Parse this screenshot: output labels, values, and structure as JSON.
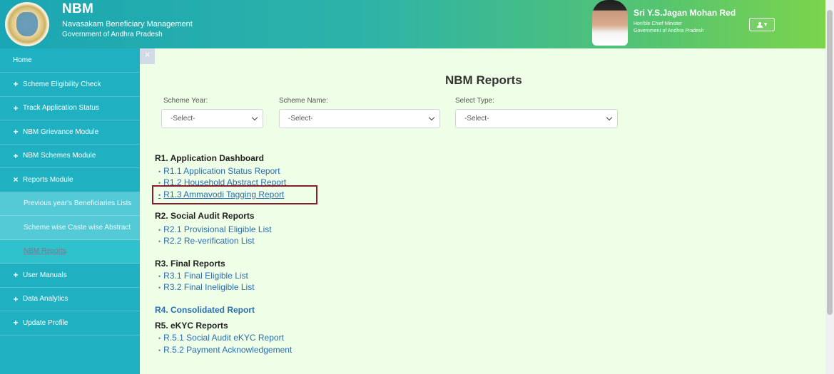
{
  "header": {
    "title": "NBM",
    "subtitle": "Navasakam Beneficiary Management",
    "gov": "Government of Andhra Pradesh",
    "cm_name": "Sri Y.S.Jagan Mohan Reddy",
    "cm_role": "Hon'ble Chief Minister",
    "cm_gov": "Government of Andhra Pradesh"
  },
  "sidebar": {
    "items": [
      {
        "label": "Home",
        "icon": "",
        "type": "home"
      },
      {
        "label": "Scheme Eligibility Check",
        "icon": "+",
        "type": "main"
      },
      {
        "label": "Track Application Status",
        "icon": "+",
        "type": "main"
      },
      {
        "label": "NBM Grievance Module",
        "icon": "+",
        "type": "main"
      },
      {
        "label": "NBM Schemes Module",
        "icon": "+",
        "type": "main"
      },
      {
        "label": "Reports Module",
        "icon": "×",
        "type": "main"
      },
      {
        "label": "Previous year's Beneficiaries Lists",
        "icon": "",
        "type": "sub"
      },
      {
        "label": "Scheme wise Caste wise Abstract",
        "icon": "",
        "type": "sub"
      },
      {
        "label": "NBM Reports",
        "icon": "",
        "type": "sub-active"
      },
      {
        "label": "User Manuals",
        "icon": "+",
        "type": "main"
      },
      {
        "label": "Data Analytics",
        "icon": "+",
        "type": "main"
      },
      {
        "label": "Update Profile",
        "icon": "+",
        "type": "main"
      }
    ],
    "close": "×"
  },
  "main": {
    "title": "NBM Reports",
    "filters": [
      {
        "label": "Scheme Year:",
        "value": "-Select-"
      },
      {
        "label": "Scheme Name:",
        "value": "-Select-"
      },
      {
        "label": "Select Type:",
        "value": "-Select-"
      }
    ],
    "sections": {
      "r1": {
        "title": "R1. Application Dashboard",
        "links": [
          "R1.1 Application Status Report",
          "R1.2 Household Abstract Report",
          "R1.3 Ammavodi Tagging Report"
        ]
      },
      "r2": {
        "title": "R2. Social Audit Reports",
        "links": [
          "R2.1 Provisional Eligible List",
          "R2.2 Re-verification List"
        ]
      },
      "r3": {
        "title": "R3. Final Reports",
        "links": [
          "R3.1 Final Eligible List",
          "R3.2 Final Ineligible List"
        ]
      },
      "r4": {
        "title": "R4. Consolidated Report"
      },
      "r5": {
        "title": "R5. eKYC Reports",
        "links": [
          "R.5.1 Social Audit eKYC Report",
          "R.5.2 Payment Acknowledgement"
        ]
      }
    }
  },
  "colors": {
    "sidebar": "#1fb1c1",
    "main_bg": "#efffe7",
    "link": "#2a6db0",
    "highlight_border": "#8b1c2b"
  }
}
